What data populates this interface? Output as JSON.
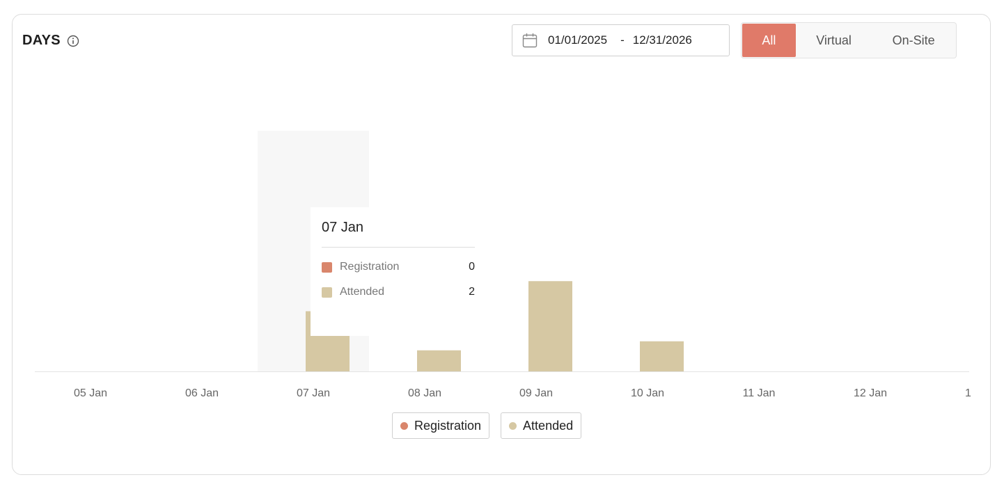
{
  "header": {
    "title": "DAYS",
    "info_icon": "info-icon"
  },
  "date_range": {
    "icon": "calendar-icon",
    "start": "01/01/2025",
    "separator": "-",
    "end": "12/31/2026"
  },
  "filter": {
    "options": [
      "All",
      "Virtual",
      "On-Site"
    ],
    "selected": "All",
    "accent": "#e07a69"
  },
  "tooltip": {
    "title": "07 Jan",
    "rows": [
      {
        "label": "Registration",
        "value": "0"
      },
      {
        "label": "Attended",
        "value": "2"
      }
    ]
  },
  "legend": {
    "items": [
      "Registration",
      "Attended"
    ]
  },
  "chart_data": {
    "type": "bar",
    "categories": [
      "05 Jan",
      "06 Jan",
      "07 Jan",
      "08 Jan",
      "09 Jan",
      "10 Jan",
      "11 Jan",
      "12 Jan",
      "1"
    ],
    "series": [
      {
        "name": "Registration",
        "color": "#d9866c",
        "values": [
          0,
          0,
          0,
          0,
          0,
          0,
          0,
          0,
          0
        ]
      },
      {
        "name": "Attended",
        "color": "#d6c8a3",
        "values": [
          0,
          0,
          2,
          0.7,
          3,
          1,
          0,
          0,
          0
        ]
      }
    ],
    "ylim": [
      0,
      8
    ],
    "grid": false,
    "highlighted_category": "07 Jan",
    "legend_position": "bottom"
  }
}
